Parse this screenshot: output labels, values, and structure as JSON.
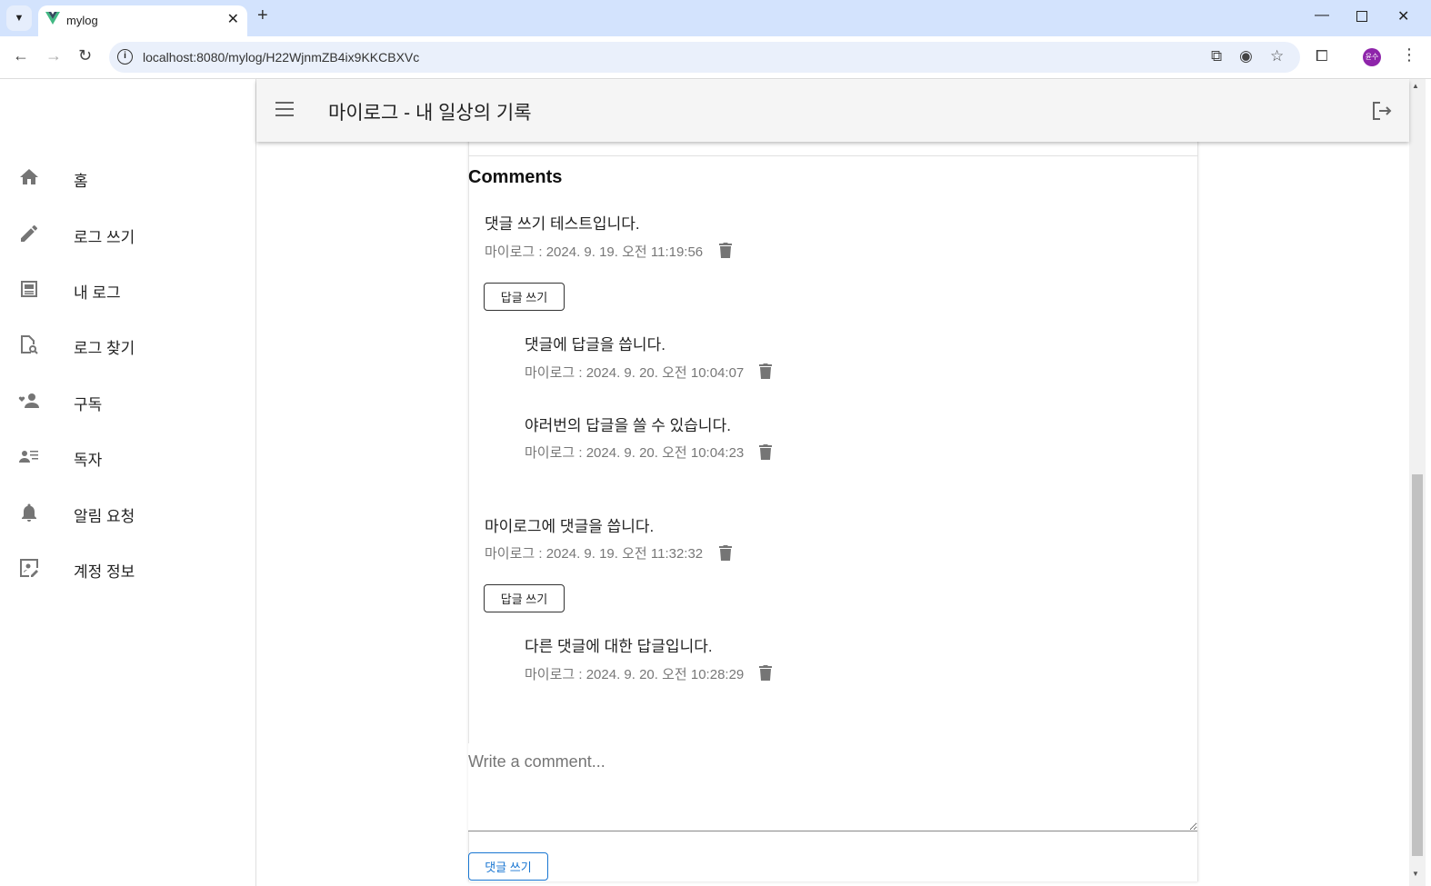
{
  "browser": {
    "tab_title": "mylog",
    "url": "localhost:8080/mylog/H22WjnmZB4ix9KKCBXVc",
    "profile": "윤수"
  },
  "header": {
    "title": "마이로그 - 내 일상의 기록"
  },
  "sidebar": {
    "items": [
      {
        "label": "홈",
        "icon": "home-icon"
      },
      {
        "label": "로그 쓰기",
        "icon": "pencil-icon"
      },
      {
        "label": "내 로그",
        "icon": "article-icon"
      },
      {
        "label": "로그 찾기",
        "icon": "find-document-icon"
      },
      {
        "label": "구독",
        "icon": "subscribe-icon"
      },
      {
        "label": "독자",
        "icon": "readers-icon"
      },
      {
        "label": "알림 요청",
        "icon": "bell-icon"
      },
      {
        "label": "계정 정보",
        "icon": "account-edit-icon"
      }
    ]
  },
  "comments": {
    "title": "Comments",
    "reply_label": "답글 쓰기",
    "items": [
      {
        "text": "댓글 쓰기 테스트입니다.",
        "meta": "마이로그 : 2024. 9. 19. 오전 11:19:56",
        "replies": [
          {
            "text": "댓글에 답글을 씁니다.",
            "meta": "마이로그 : 2024. 9. 20. 오전 10:04:07"
          },
          {
            "text": "야러번의 답글을 쓸 수 있습니다.",
            "meta": "마이로그 : 2024. 9. 20. 오전 10:04:23"
          }
        ]
      },
      {
        "text": "마이로그에 댓글을 씁니다.",
        "meta": "마이로그 : 2024. 9. 19. 오전 11:32:32",
        "replies": [
          {
            "text": "다른 댓글에 대한 답글입니다.",
            "meta": "마이로그 : 2024. 9. 20. 오전 10:28:29"
          }
        ]
      }
    ],
    "input_placeholder": "Write a comment...",
    "submit_label": "댓글 쓰기"
  }
}
